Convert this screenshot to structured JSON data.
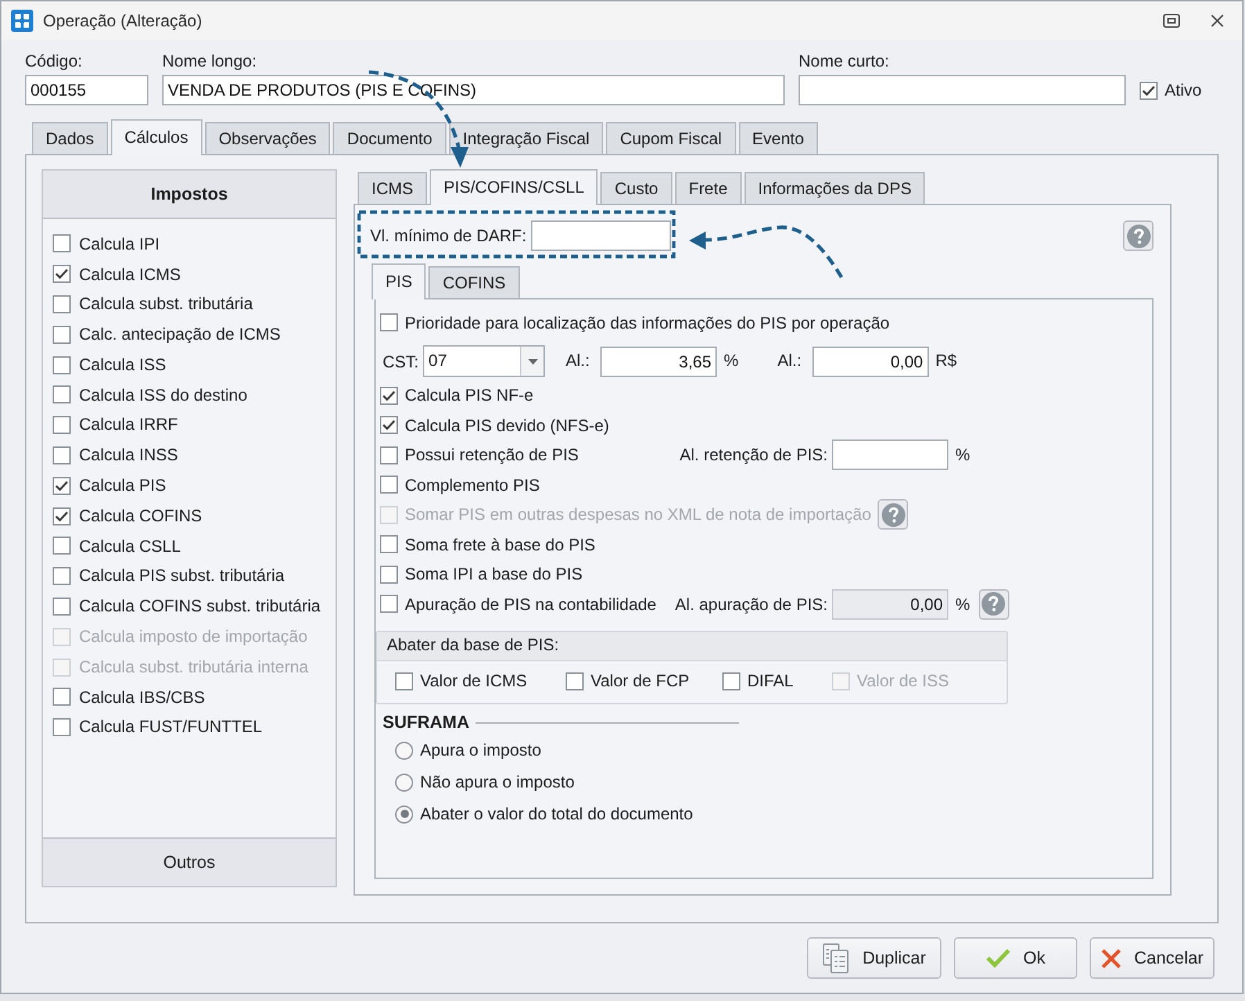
{
  "window": {
    "title": "Operação (Alteração)"
  },
  "header": {
    "fields": [
      {
        "label": "Código:",
        "value": "000155"
      },
      {
        "label": "Nome longo:",
        "value": "VENDA DE PRODUTOS (PIS E COFINS)"
      },
      {
        "label": "Nome curto:"
      }
    ],
    "active": {
      "label": "Ativo",
      "checked": true
    }
  },
  "tabs": [
    {
      "label": "Dados",
      "selected": false
    },
    {
      "label": "Cálculos",
      "selected": true
    },
    {
      "label": "Observações",
      "selected": false
    },
    {
      "label": "Documento",
      "selected": false
    },
    {
      "label": "Integração Fiscal",
      "selected": false
    },
    {
      "label": "Cupom Fiscal",
      "selected": false
    },
    {
      "label": "Evento",
      "selected": false
    }
  ],
  "taxes_panel": {
    "title": "Impostos",
    "items": [
      {
        "label": "Calcula IPI",
        "checked": false,
        "disabled": false
      },
      {
        "label": "Calcula ICMS",
        "checked": true,
        "disabled": false
      },
      {
        "label": "Calcula subst. tributária",
        "checked": false,
        "disabled": false
      },
      {
        "label": "Calc. antecipação de ICMS",
        "checked": false,
        "disabled": false
      },
      {
        "label": "Calcula ISS",
        "checked": false,
        "disabled": false
      },
      {
        "label": "Calcula ISS do destino",
        "checked": false,
        "disabled": false
      },
      {
        "label": "Calcula IRRF",
        "checked": false,
        "disabled": false
      },
      {
        "label": "Calcula INSS",
        "checked": false,
        "disabled": false
      },
      {
        "label": "Calcula PIS",
        "checked": true,
        "disabled": false
      },
      {
        "label": "Calcula COFINS",
        "checked": true,
        "disabled": false
      },
      {
        "label": "Calcula CSLL",
        "checked": false,
        "disabled": false
      },
      {
        "label": "Calcula PIS subst. tributária",
        "checked": false,
        "disabled": false
      },
      {
        "label": "Calcula COFINS subst. tributária",
        "checked": false,
        "disabled": false
      },
      {
        "label": "Calcula imposto de importação",
        "checked": false,
        "disabled": true
      },
      {
        "label": "Calcula subst. tributária interna",
        "checked": false,
        "disabled": true
      },
      {
        "label": "Calcula IBS/CBS",
        "checked": false,
        "disabled": false
      },
      {
        "label": "Calcula FUST/FUNTTEL",
        "checked": false,
        "disabled": false
      }
    ],
    "footer_button": "Outros"
  },
  "sub_tabs": [
    {
      "label": "ICMS",
      "selected": false
    },
    {
      "label": "PIS/COFINS/CSLL",
      "selected": true
    },
    {
      "label": "Custo",
      "selected": false
    },
    {
      "label": "Frete",
      "selected": false
    },
    {
      "label": "Informações da DPS",
      "selected": false
    }
  ],
  "darf": {
    "label": "Vl. mínimo de DARF:"
  },
  "tax_tabs": [
    {
      "label": "PIS",
      "selected": true
    },
    {
      "label": "COFINS",
      "selected": false
    }
  ],
  "pis_rows": [
    {
      "kind": "checkbox",
      "label": "Prioridade para localização das informações do PIS por operação",
      "checked": false,
      "disabled": false
    },
    {
      "kind": "cst",
      "label": "CST:",
      "value": "07",
      "rates": [
        {
          "label": "Al.:",
          "value": "3,65",
          "unit": "%"
        },
        {
          "label": "Al.:",
          "value": "0,00",
          "unit": "R$"
        }
      ]
    },
    {
      "kind": "checkbox",
      "label": "Calcula PIS NF-e",
      "checked": true,
      "disabled": false
    },
    {
      "kind": "checkbox",
      "label": "Calcula PIS devido (NFS-e)",
      "checked": true,
      "disabled": false
    },
    {
      "kind": "checkbox_rate",
      "label": "Possui retenção de PIS",
      "checked": false,
      "disabled": false,
      "rate": {
        "label": "Al. retenção de PIS:",
        "unit": "%",
        "disabled": false
      }
    },
    {
      "kind": "checkbox",
      "label": "Complemento PIS",
      "checked": false,
      "disabled": false
    },
    {
      "kind": "checkbox",
      "label": "Somar PIS em outras despesas no XML de nota de importação",
      "checked": false,
      "disabled": true,
      "help": true
    },
    {
      "kind": "checkbox",
      "label": "Soma frete à base do PIS",
      "checked": false,
      "disabled": false
    },
    {
      "kind": "checkbox",
      "label": "Soma IPI a base do PIS",
      "checked": false,
      "disabled": false
    },
    {
      "kind": "checkbox_rate",
      "label": "Apuração de PIS na contabilidade",
      "checked": false,
      "disabled": false,
      "rate": {
        "label": "Al. apuração de PIS:",
        "value": "0,00",
        "unit": "%",
        "disabled": true
      },
      "help": true
    }
  ],
  "deduct_group": {
    "title": "Abater da base de PIS:",
    "items": [
      {
        "label": "Valor de ICMS",
        "checked": false,
        "disabled": false
      },
      {
        "label": "Valor de FCP",
        "checked": false,
        "disabled": false
      },
      {
        "label": "DIFAL",
        "checked": false,
        "disabled": false
      },
      {
        "label": "Valor de ISS",
        "checked": false,
        "disabled": true
      }
    ]
  },
  "suframa": {
    "title": "SUFRAMA",
    "options": [
      {
        "label": "Apura o imposto",
        "selected": false
      },
      {
        "label": "Não apura o imposto",
        "selected": false
      },
      {
        "label": "Abater o valor do total do documento",
        "selected": true
      }
    ]
  },
  "buttons": [
    {
      "kind": "duplicate",
      "label": "Duplicar"
    },
    {
      "kind": "ok",
      "label": "Ok"
    },
    {
      "kind": "cancel",
      "label": "Cancelar"
    }
  ]
}
